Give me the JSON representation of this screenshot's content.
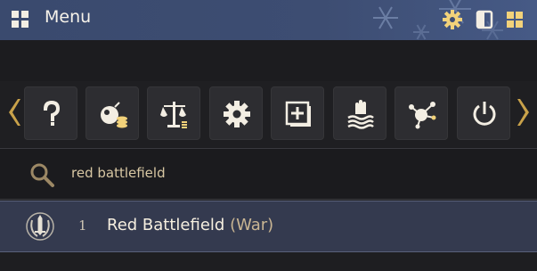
{
  "window": {
    "title": "Menu",
    "icons": [
      "grid-menu-icon",
      "settings-gear-icon",
      "panel-toggle-icon",
      "grid-view-icon"
    ]
  },
  "toolbar": {
    "buttons": [
      {
        "name": "help",
        "icon": "question-mark-icon"
      },
      {
        "name": "consumables",
        "icon": "bomb-coins-icon"
      },
      {
        "name": "market",
        "icon": "scales-icon"
      },
      {
        "name": "settings",
        "icon": "gear-icon"
      },
      {
        "name": "expand",
        "icon": "plus-square-icon"
      },
      {
        "name": "fishing",
        "icon": "hand-waves-icon"
      },
      {
        "name": "network",
        "icon": "hub-nodes-icon"
      },
      {
        "name": "power",
        "icon": "power-icon"
      }
    ],
    "prev_icon": "chevron-left-icon",
    "next_icon": "chevron-right-icon"
  },
  "search": {
    "value": "red battlefield",
    "icon": "magnifier-icon"
  },
  "results": [
    {
      "index": "1",
      "name": "Red Battlefield",
      "tag": "(War)",
      "icon": "sword-emblem-icon"
    }
  ],
  "colors": {
    "titlebar": "#3d4d72",
    "accent_gold": "#c9a24a",
    "result_highlight": "#343a4f",
    "button_bg": "#2d2d31"
  }
}
